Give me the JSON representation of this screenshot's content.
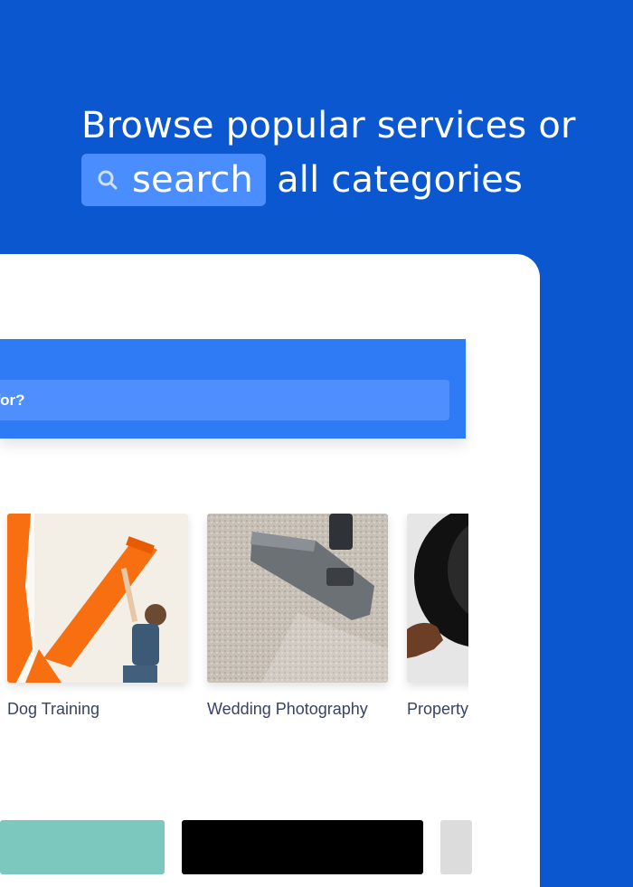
{
  "hero": {
    "line1": "Browse popular services or",
    "search_word": "search",
    "line2_rest": "all categories"
  },
  "search_panel": {
    "placeholder_visible": "ng for?"
  },
  "categories": [
    {
      "label": "Dog Training",
      "image": "painter-wall-photo"
    },
    {
      "label": "Wedding Photography",
      "image": "vacuum-carpet-photo"
    },
    {
      "label": "Property Mainten",
      "image": "dish-photo"
    }
  ],
  "colors": {
    "background": "#0b57d0",
    "search_pill": "#4a8dff",
    "panel": "#2f7af5",
    "field": "#4f8ffd",
    "card": "#ffffff",
    "label_text": "#374264"
  }
}
